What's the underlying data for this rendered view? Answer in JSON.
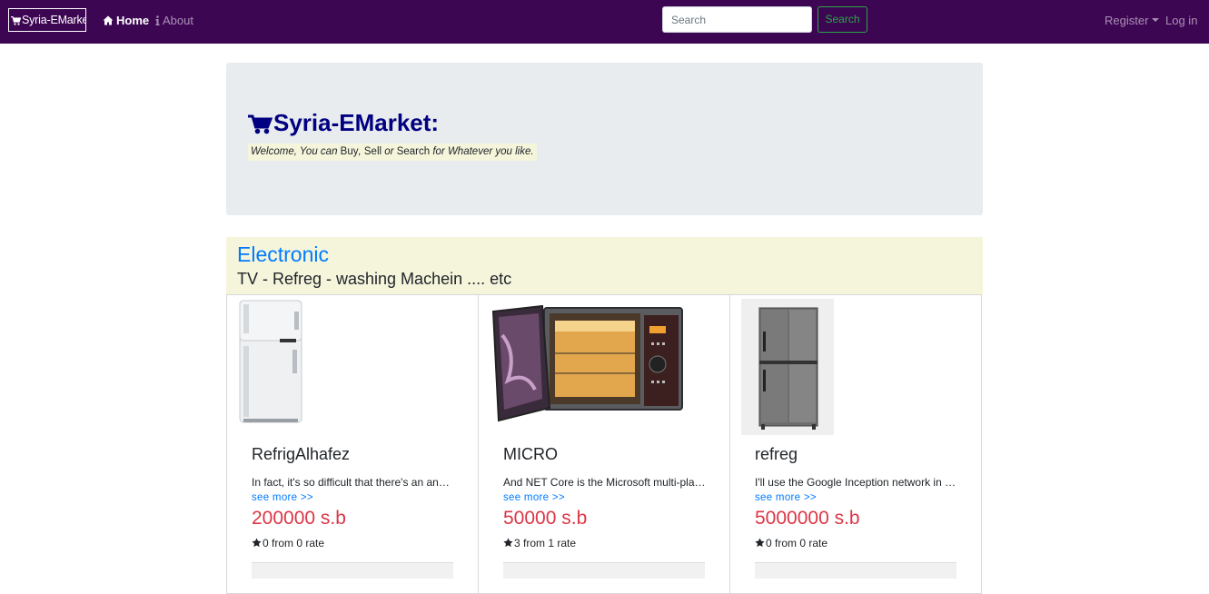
{
  "navbar": {
    "brand": "Syria-EMarket",
    "home_label": "Home",
    "about_label": "About",
    "search_placeholder": "Search",
    "search_button": "Search",
    "register_label": "Register",
    "login_label": "Log in",
    "background_color": "#3d0653"
  },
  "jumbotron": {
    "title": "Syria-EMarket:",
    "welcome_prefix": "Welcome, You can ",
    "buy": "Buy",
    "sep1": ", ",
    "sell": "Sell",
    "or": " or ",
    "search": "Search",
    "welcome_suffix": " for Whatever you like.",
    "title_color": "#000080"
  },
  "category": {
    "title": "Electronic",
    "subtitle": "TV - Refreg - washing Machein .... etc"
  },
  "products": [
    {
      "name": "RefrigAlhafez",
      "description": "In fact, it's so difficult that there's an announcement",
      "more": "see more >>",
      "price": "200000 s.b",
      "rating": "0 from 0 rate",
      "image_icon": "white-fridge-image"
    },
    {
      "name": "MICRO",
      "description": "And NET Core is the Microsoft multi-platform framework",
      "more": "see more >>",
      "price": "50000 s.b",
      "rating": "3 from 1 rate",
      "image_icon": "microwave-image"
    },
    {
      "name": "refreg",
      "description": "I'll use the Google Inception network in this example",
      "more": "see more >>",
      "price": "5000000 s.b",
      "rating": "0 from 0 rate",
      "image_icon": "grey-fridge-image"
    }
  ]
}
